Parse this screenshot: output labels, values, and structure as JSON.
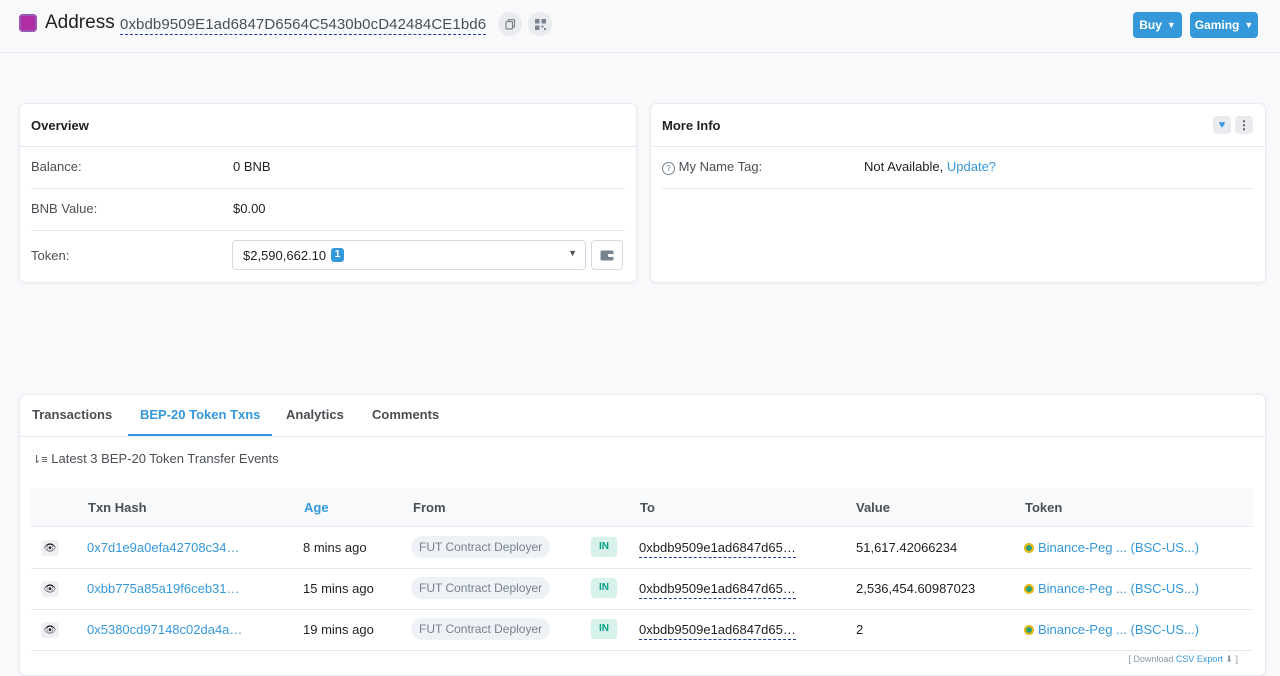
{
  "header": {
    "title": "Address",
    "address": "0xbdb9509E1ad6847D6564C5430b0cD42484CE1bd6",
    "buy_label": "Buy",
    "gaming_label": "Gaming"
  },
  "overview": {
    "title": "Overview",
    "balance_label": "Balance:",
    "balance_value": "0 BNB",
    "bnb_value_label": "BNB Value:",
    "bnb_value": "$0.00",
    "token_label": "Token:",
    "token_value": "$2,590,662.10",
    "token_count": "1"
  },
  "more_info": {
    "title": "More Info",
    "name_tag_label": "My Name Tag:",
    "name_tag_value": "Not Available,",
    "update_link": "Update?"
  },
  "tabs": [
    {
      "label": "Transactions"
    },
    {
      "label": "BEP-20 Token Txns"
    },
    {
      "label": "Analytics"
    },
    {
      "label": "Comments"
    }
  ],
  "latest_text": "Latest 3 BEP-20 Token Transfer Events",
  "table": {
    "headers": [
      "Txn Hash",
      "Age",
      "From",
      "To",
      "Value",
      "Token"
    ],
    "rows": [
      {
        "hash": "0x7d1e9a0efa42708c34…",
        "age": "8 mins ago",
        "from": "FUT Contract Deployer",
        "dir": "IN",
        "to": "0xbdb9509e1ad6847d65…",
        "value": "51,617.42066234",
        "token": "Binance-Peg ... (BSC-US...)"
      },
      {
        "hash": "0xbb775a85a19f6ceb31…",
        "age": "15 mins ago",
        "from": "FUT Contract Deployer",
        "dir": "IN",
        "to": "0xbdb9509e1ad6847d65…",
        "value": "2,536,454.60987023",
        "token": "Binance-Peg ... (BSC-US...)"
      },
      {
        "hash": "0x5380cd97148c02da4a…",
        "age": "19 mins ago",
        "from": "FUT Contract Deployer",
        "dir": "IN",
        "to": "0xbdb9509e1ad6847d65…",
        "value": "2",
        "token": "Binance-Peg ... (BSC-US...)"
      }
    ]
  },
  "csv": {
    "prefix": "[ Download",
    "link": "CSV Export",
    "suffix": "]"
  },
  "colors": {
    "accent": "#3498db",
    "in_badge": "#00a186",
    "page_bg": "#f8f9fa"
  }
}
